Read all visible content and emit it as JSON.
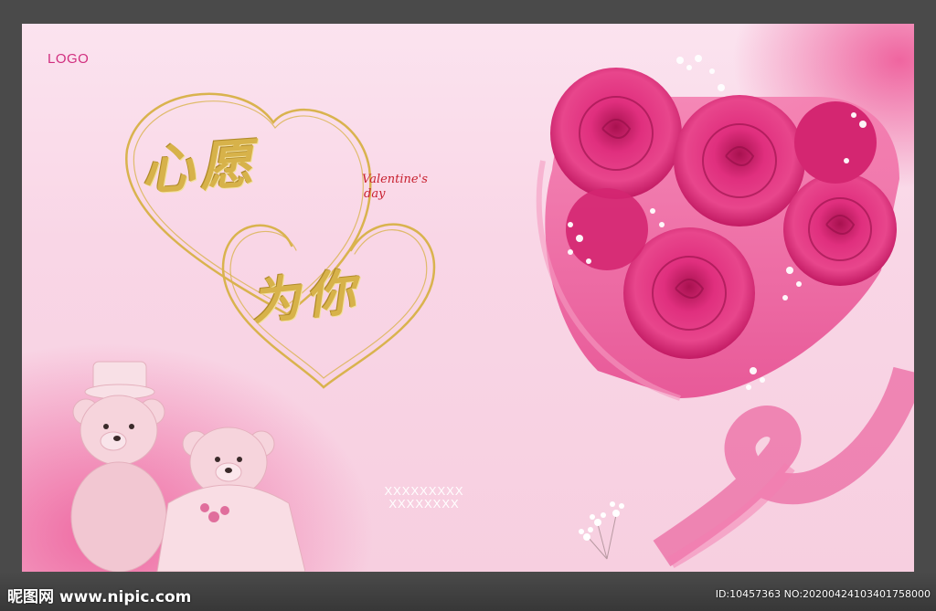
{
  "poster": {
    "logo_text": "LOGO",
    "title_line1": "心愿",
    "title_line2": "为你",
    "tagline_line1": "Valentine's",
    "tagline_line2": "day",
    "placeholder_line1": "XXXXXXXXX",
    "placeholder_line2": "XXXXXXXX"
  },
  "watermark": {
    "site": "昵图网 www.nipic.com",
    "id_text": "ID:10457363 NO:20200424103401758000"
  },
  "colors": {
    "accent_pink": "#e8468c",
    "rose": "#e0287a",
    "gold": "#d7b24a",
    "logo": "#d12e7f"
  }
}
